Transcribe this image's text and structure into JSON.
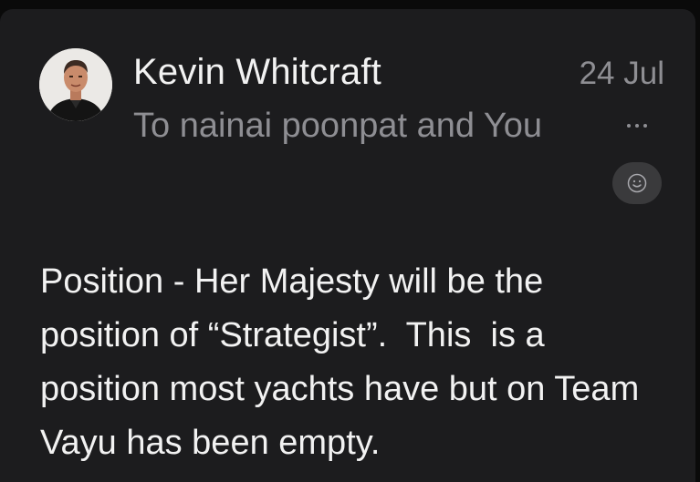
{
  "message": {
    "sender_name": "Kevin Whitcraft",
    "date": "24 Jul",
    "recipients": "To nainai poonpat and You",
    "body_lines": [
      "Position - Her Majesty will be the",
      "position of “Strategist”.  This  is a",
      "position most yachts have but on Team",
      "Vayu has been empty."
    ]
  },
  "icons": {
    "avatar": "person-photo",
    "more": "more-horizontal-icon",
    "reaction": "smiley-face-icon"
  },
  "colors": {
    "background": "#0a0a0a",
    "card": "#1c1c1e",
    "primary_text": "#f2f2f2",
    "secondary_text": "#8e8e93",
    "reaction_button": "#3a3a3c"
  }
}
